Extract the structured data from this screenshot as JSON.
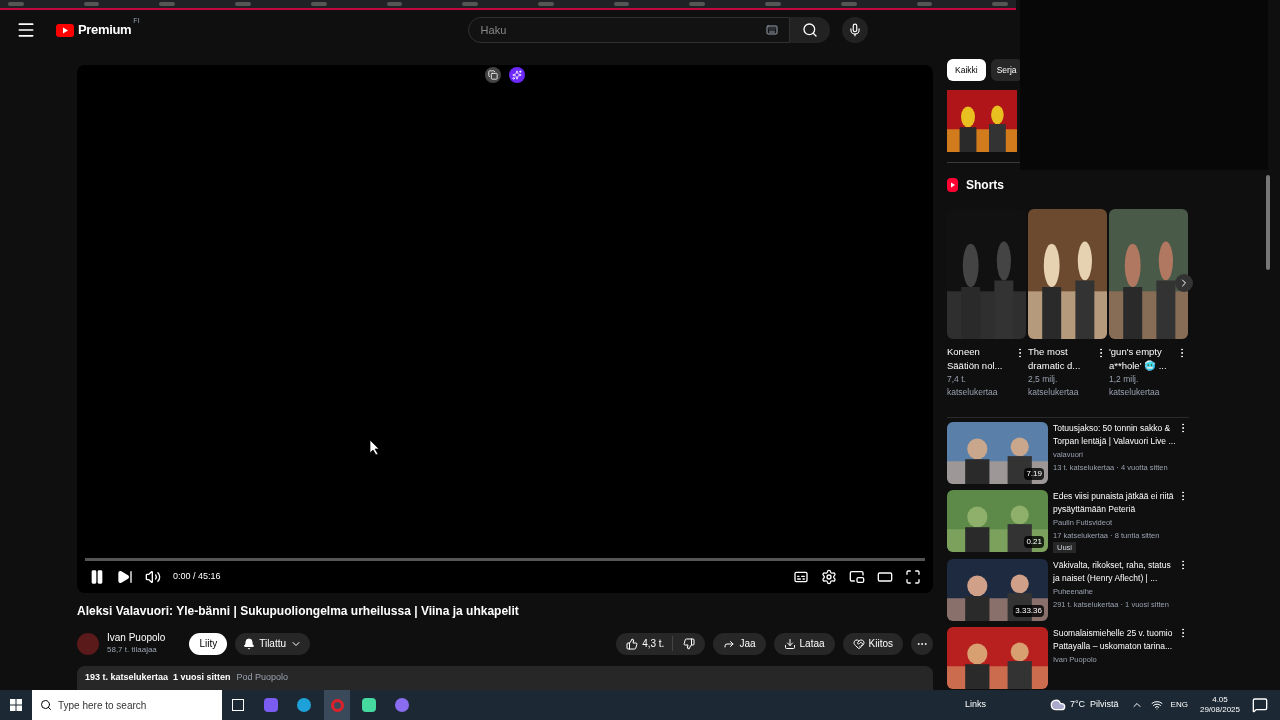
{
  "header": {
    "logo": "Premium",
    "region": "FI",
    "search": {
      "placeholder": "Haku"
    }
  },
  "player": {
    "playing": true,
    "time": "0:00 / 45:16"
  },
  "video": {
    "title": "Aleksi Valavuori: Yle-bänni | Sukupuoliongelma urheilussa | Viina ja uhkapelit",
    "channel": "Ivan Puopolo",
    "subscribers": "58,7 t. tilaajaa",
    "join": "Liity",
    "subscribe": "Tilattu",
    "likes": "4,3 t.",
    "share": "Jaa",
    "download": "Lataa",
    "thanks": "Kiitos",
    "description": "193 t. katselukertaa  1 vuosi sitten",
    "tag": "Pod Puopolo"
  },
  "chips": [
    {
      "label": "Kaikki",
      "selected": true
    },
    {
      "label": "Serja",
      "selected": false
    }
  ],
  "shorts": {
    "title": "Shorts",
    "items": [
      {
        "title": "Koneen Säätiön nol...",
        "views": "7,4 t. katselukertaa"
      },
      {
        "title": "The most dramatic d...",
        "views": "2,5 milj. katselukertaa"
      },
      {
        "title": "'gun's empty a**hole' 🥶 ...",
        "views": "1,2 milj. katselukertaa"
      }
    ]
  },
  "videos": [
    {
      "title": "Totuusjakso: 50 tonnin sakko & Torpan lentäjä | Valavuori Live ...",
      "channel": "valavuori",
      "meta": "13 t. katselukertaa · 4 vuotta sitten",
      "duration": "7.19"
    },
    {
      "title": "Edes viisi punaista jätkää ei riitä pysäyttämään Peteriä",
      "channel": "Paulin Futisvideot",
      "meta": "17 katselukertaa · 8 tuntia sitten",
      "duration": "0.21",
      "badge": "Uusi"
    },
    {
      "title": "Väkivalta, rikokset, raha, status ja naiset (Henry Aflecht) | ...",
      "channel": "Puheenaihe",
      "meta": "291 t. katselukertaa · 1 vuosi sitten",
      "duration": "3.33.36"
    },
    {
      "title": "Suomalaismiehelle 25 v. tuomio Pattayalla – uskomaton tarina...",
      "channel": "Ivan Puopolo"
    }
  ],
  "taskbar": {
    "search": {
      "placeholder": "Type here to search"
    },
    "links": "Links",
    "weather": "7°C  Pilvistä",
    "lang": "ENG",
    "time": "4.05",
    "date": "29/08/2025"
  }
}
